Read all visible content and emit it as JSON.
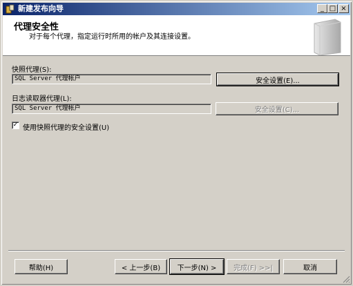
{
  "window": {
    "title": "新建发布向导",
    "controls": {
      "minimize": "_",
      "maximize": "□",
      "close": "×"
    }
  },
  "header": {
    "title": "代理安全性",
    "subtitle": "对于每个代理，指定运行时所用的帐户及其连接设置。"
  },
  "snapshot_agent": {
    "label": "快照代理(S):",
    "value": "SQL Server 代理帐户",
    "button": "安全设置(E)..."
  },
  "log_reader_agent": {
    "label": "日志读取器代理(L):",
    "value": "SQL Server 代理帐户",
    "button": "安全设置(C)..."
  },
  "option": {
    "label": "使用快照代理的安全设置(U)",
    "checked": true,
    "check_glyph": "✓"
  },
  "footer": {
    "help": "帮助(H)",
    "back": "< 上一步(B)",
    "next": "下一步(N) >",
    "finish": "完成(F) >>|",
    "cancel": "取消"
  }
}
